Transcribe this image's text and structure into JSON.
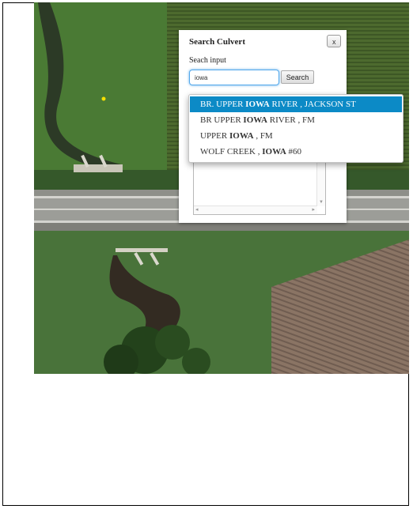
{
  "dialog": {
    "title": "Search Culvert",
    "close_label": "x",
    "input_label": "Seach input",
    "input_value": "iowa",
    "search_button": "Search"
  },
  "autocomplete": {
    "items": [
      {
        "pre": "BR. UPPER ",
        "match": "IOWA",
        "post": " RIVER , JACKSON ST",
        "selected": true
      },
      {
        "pre": "BR UPPER ",
        "match": "IOWA",
        "post": " RIVER , FM",
        "selected": false
      },
      {
        "pre": "UPPER ",
        "match": "IOWA",
        "post": " , FM",
        "selected": false
      },
      {
        "pre": "WOLF CREEK , ",
        "match": "IOWA",
        "post": " #60",
        "selected": false
      }
    ]
  },
  "colors": {
    "selected_bg": "#0c8ac6",
    "input_focus": "#66afe9"
  }
}
